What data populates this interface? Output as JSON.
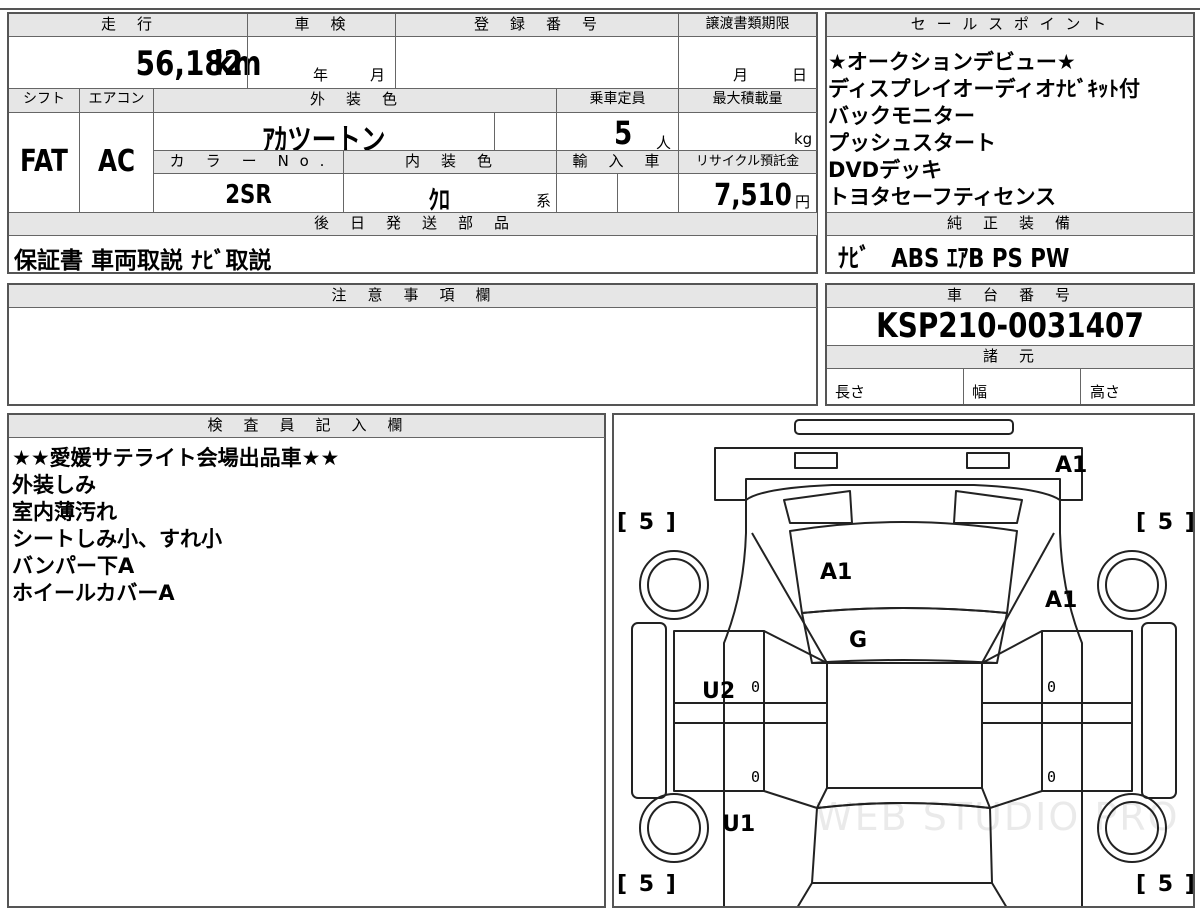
{
  "vehicle": {
    "headers": {
      "mileage": "走　行",
      "inspection": "車　検",
      "registration": "登　録　番　号",
      "transfer_deadline": "譲渡書類期限",
      "shift": "シフト",
      "aircon": "エアコン",
      "exterior_color": "外　装　色",
      "capacity": "乗車定員",
      "max_load": "最大積載量",
      "color_no": "カ　ラ　ー　N o .",
      "interior_color": "内　装　色",
      "import": "輸　入　車",
      "recycle_fee": "リサイクル預託金"
    },
    "mileage_value": "56,182",
    "mileage_unit": "km",
    "inspection_year": "年",
    "inspection_month": "月",
    "transfer_month": "月",
    "transfer_day": "日",
    "shift_value": "FAT",
    "aircon_value": "AC",
    "exterior_color_value": "ｱｶツートン",
    "capacity_value": "5",
    "capacity_unit": "人",
    "max_load_unit": "kg",
    "color_no_value": "2SR",
    "interior_color_value": "ｸﾛ",
    "interior_color_suffix": "系",
    "recycle_value": "7,510",
    "recycle_unit": "円"
  },
  "later_parts": {
    "header": "後　日　発　送　部　品",
    "value": "保証書 車両取説 ﾅﾋﾞ取説"
  },
  "sales_points": {
    "header": "セ ー ル ス ポ イ ン ト",
    "items": [
      "★オークションデビュー★",
      "ディスプレイオーディオﾅﾋﾞｷｯﾄ付",
      "バックモニター",
      "プッシュスタート",
      "DVDデッキ",
      "トヨタセーフティセンス"
    ]
  },
  "genuine_equipment": {
    "header": "純　正　装　備",
    "value": "ﾅﾋﾞ　ABS ｴｱB PS PW"
  },
  "notes": {
    "header": "注　意　事　項　欄",
    "value": ""
  },
  "chassis": {
    "header": "車　台　番　号",
    "value": "KSP210-0031407",
    "specs_header": "諸　元",
    "length_label": "長さ",
    "width_label": "幅",
    "height_label": "高さ"
  },
  "inspector": {
    "header": "検　査　員　記　入　欄",
    "lines": [
      "★★愛媛サテライト会場出品車★★",
      "外装しみ",
      "室内薄汚れ",
      "シートしみ小、すれ小",
      "バンパー下A",
      "ホイールカバーA"
    ]
  },
  "diagram": {
    "marks": {
      "rear_right": "A1",
      "windshield": "A1",
      "roof_side": "A1",
      "glass": "G",
      "left_door": "U2",
      "left_rear": "U1"
    },
    "zeros": [
      "0",
      "0",
      "0",
      "0"
    ],
    "tires": {
      "front_left": "5",
      "front_right": "5",
      "rear_left": "5",
      "rear_right": "5"
    },
    "watermark": "WEB STUDIO PRO"
  }
}
